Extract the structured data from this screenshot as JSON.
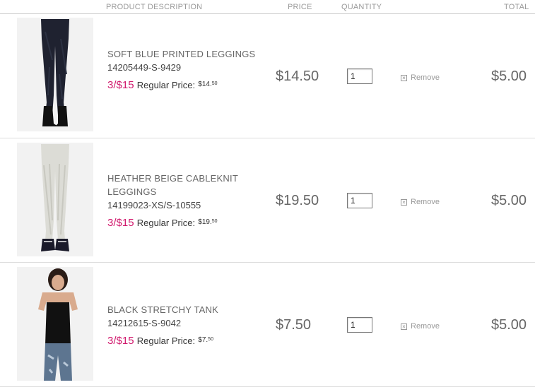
{
  "header": {
    "desc": "PRODUCT DESCRIPTION",
    "price": "PRICE",
    "quantity": "QUANTITY",
    "total": "TOTAL"
  },
  "items": [
    {
      "name": "SOFT BLUE PRINTED LEGGINGS",
      "sku": "14205449-S-9429",
      "deal": "3/$15",
      "regular_label": "Regular Price:",
      "regular_price": "$14.",
      "regular_cents": "50",
      "price": "$14.50",
      "quantity": "1",
      "remove": "Remove",
      "total": "$5.00",
      "image": "dark-leggings-photo"
    },
    {
      "name": "HEATHER BEIGE CABLEKNIT LEGGINGS",
      "sku": "14199023-XS/S-10555",
      "deal": "3/$15",
      "regular_label": "Regular Price:",
      "regular_price": "$19.",
      "regular_cents": "50",
      "price": "$19.50",
      "quantity": "1",
      "remove": "Remove",
      "total": "$5.00",
      "image": "beige-leggings-photo"
    },
    {
      "name": "BLACK STRETCHY TANK",
      "sku": "14212615-S-9042",
      "deal": "3/$15",
      "regular_label": "Regular Price:",
      "regular_price": "$7.",
      "regular_cents": "50",
      "price": "$7.50",
      "quantity": "1",
      "remove": "Remove",
      "total": "$5.00",
      "image": "black-tank-photo"
    }
  ],
  "colors": {
    "deal": "#d0186c",
    "text": "#666666",
    "divider": "#dddddd"
  }
}
